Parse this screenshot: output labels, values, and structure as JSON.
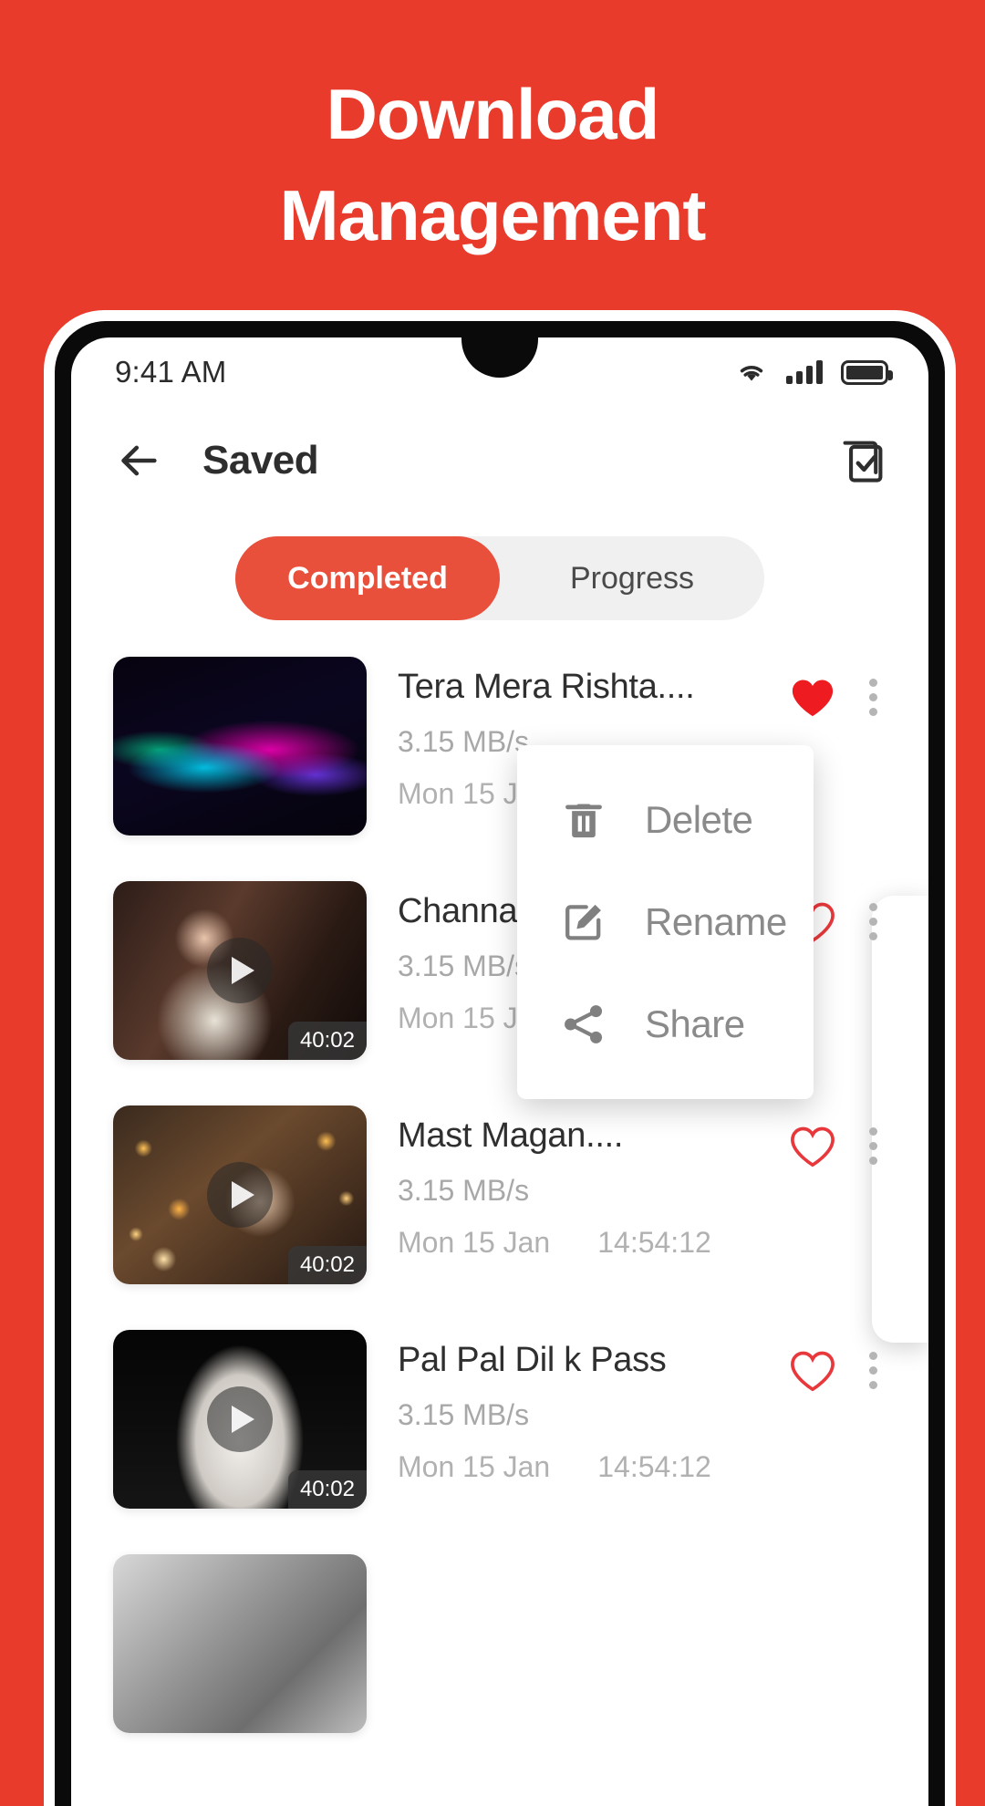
{
  "promo": {
    "line1": "Download",
    "line2": "Management",
    "bg_color": "#E93B2B",
    "text_color": "#FFFFFF"
  },
  "statusbar": {
    "time": "9:41 AM",
    "wifi_icon": "wifi-icon",
    "signal_icon": "cellular-signal-icon",
    "battery_icon": "battery-full-icon"
  },
  "appbar": {
    "back_icon": "back-arrow-icon",
    "title": "Saved",
    "select_icon": "select-all-checkbox-icon"
  },
  "tabs": {
    "active_color": "#E8503C",
    "track_color": "#F0F0F0",
    "items": [
      {
        "label": "Completed",
        "active": true
      },
      {
        "label": "Progress",
        "active": false
      }
    ]
  },
  "downloads": [
    {
      "title": "Tera Mera Rishta....",
      "speed": "3.15 MB/s",
      "date": "Mon 15 Jan",
      "time": "",
      "duration": "",
      "favorite": true,
      "art": "art-wave",
      "has_play": false
    },
    {
      "title": "Channa Me",
      "speed": "3.15 MB/s",
      "date": "Mon 15 Jan",
      "time": "",
      "duration": "40:02",
      "favorite": false,
      "art": "art-girl1",
      "has_play": true
    },
    {
      "title": "Mast Magan....",
      "speed": "3.15 MB/s",
      "date": "Mon 15 Jan",
      "time": "14:54:12",
      "duration": "40:02",
      "favorite": false,
      "art": "art-bokeh",
      "has_play": true
    },
    {
      "title": "Pal Pal Dil k Pass",
      "speed": "3.15 MB/s",
      "date": "Mon 15 Jan",
      "time": "14:54:12",
      "duration": "40:02",
      "favorite": false,
      "art": "art-spot",
      "has_play": true
    },
    {
      "title": "",
      "speed": "",
      "date": "",
      "time": "",
      "duration": "",
      "favorite": false,
      "art": "art-bw",
      "has_play": false
    }
  ],
  "context_menu": {
    "items": [
      {
        "label": "Delete",
        "icon": "trash-icon"
      },
      {
        "label": "Rename",
        "icon": "edit-pencil-icon"
      },
      {
        "label": "Share",
        "icon": "share-nodes-icon"
      }
    ],
    "text_color": "#8A8A8A"
  },
  "colors": {
    "accent": "#E8503C",
    "promo_bg": "#E93B2B",
    "heart_filled": "#EE1C20",
    "heart_outline": "#E8383C",
    "muted_text": "#B1B1B1"
  }
}
